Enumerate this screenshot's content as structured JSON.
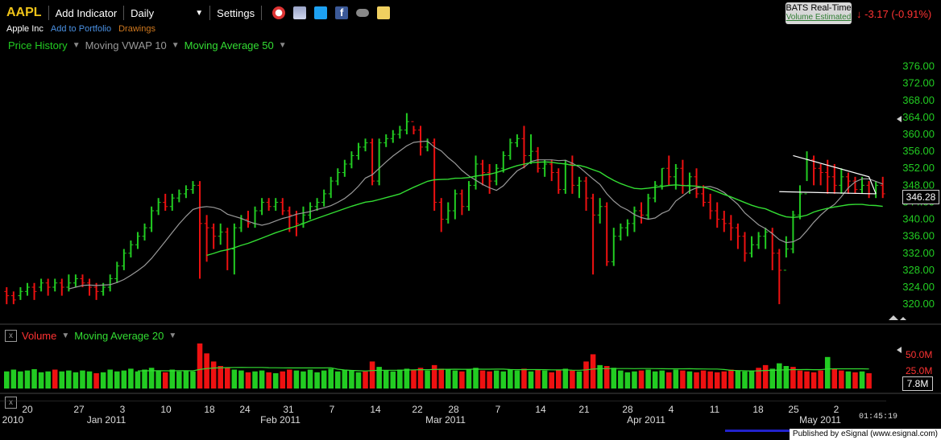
{
  "toolbar": {
    "symbol": "AAPL",
    "add_indicator": "Add Indicator",
    "interval": "Daily",
    "settings": "Settings",
    "icons": [
      "alarm-clock-icon",
      "cylinder-icon",
      "twitter-icon",
      "facebook-icon",
      "binoculars-icon",
      "note-icon"
    ],
    "realtime_title": "BATS Real-Time",
    "realtime_sub": "Volume Estimated",
    "change": "-3.17 (-0.91%)"
  },
  "subbar": {
    "company": "Apple Inc",
    "portfolio": "Add to Portfolio",
    "drawings": "Drawings"
  },
  "indicators": {
    "price_history": "Price History",
    "vwap": "Moving VWAP 10",
    "ma50": "Moving Average 50"
  },
  "volume_pane": {
    "label": "Volume",
    "ma": "Moving Average 20",
    "ticks": [
      "50.0M",
      "25.0M"
    ],
    "current": "7.8M"
  },
  "price_axis": [
    "376.00",
    "372.00",
    "368.00",
    "364.00",
    "360.00",
    "356.00",
    "352.00",
    "348.00",
    "344.00",
    "340.00",
    "336.00",
    "332.00",
    "328.00",
    "324.00",
    "320.00"
  ],
  "current_price": "346.28",
  "x_axis": {
    "days": [
      "2010",
      "20",
      "27",
      "3",
      "10",
      "18",
      "24",
      "31",
      "7",
      "14",
      "22",
      "28",
      "7",
      "14",
      "21",
      "28",
      "4",
      "11",
      "18",
      "25",
      "2"
    ],
    "months": [
      "Jan 2011",
      "Feb 2011",
      "Mar 2011",
      "Apr 2011",
      "May 2011"
    ]
  },
  "clock": "01:45:19",
  "footer": "Published by eSignal (www.esignal.com)",
  "colors": {
    "up": "#22cc22",
    "down": "#ee1111",
    "ma50": "#33dd33",
    "vwap": "#999999",
    "accent": "#f0c419"
  },
  "chart_data": {
    "type": "ohlc",
    "ylim": [
      317,
      378
    ],
    "bars": [
      [
        323,
        322,
        320,
        324
      ],
      [
        322,
        321,
        320,
        323
      ],
      [
        322,
        323,
        321,
        324
      ],
      [
        323,
        324,
        322,
        325
      ],
      [
        324,
        323,
        321,
        325
      ],
      [
        324,
        325,
        323,
        326
      ],
      [
        325,
        324,
        322,
        326
      ],
      [
        324,
        325,
        323,
        326
      ],
      [
        325,
        324,
        322,
        326
      ],
      [
        324,
        325,
        323,
        327
      ],
      [
        325,
        326,
        324,
        327
      ],
      [
        326,
        325,
        324,
        327
      ],
      [
        325,
        324,
        322,
        326
      ],
      [
        324,
        323,
        321,
        325
      ],
      [
        323,
        324,
        322,
        325
      ],
      [
        324,
        326,
        323,
        327
      ],
      [
        326,
        329,
        325,
        330
      ],
      [
        329,
        332,
        328,
        333
      ],
      [
        332,
        334,
        331,
        335
      ],
      [
        334,
        336,
        333,
        337
      ],
      [
        336,
        338,
        335,
        339
      ],
      [
        338,
        342,
        337,
        343
      ],
      [
        342,
        344,
        341,
        345
      ],
      [
        344,
        343,
        342,
        346
      ],
      [
        343,
        345,
        342,
        346
      ],
      [
        345,
        346,
        344,
        347
      ],
      [
        346,
        347,
        345,
        348
      ],
      [
        347,
        348,
        346,
        349
      ],
      [
        348,
        339,
        326,
        349
      ],
      [
        339,
        338,
        330,
        341
      ],
      [
        338,
        336,
        333,
        339
      ],
      [
        336,
        337,
        334,
        339
      ],
      [
        337,
        333,
        328,
        338
      ],
      [
        333,
        338,
        327,
        339
      ],
      [
        338,
        340,
        337,
        341
      ],
      [
        340,
        339,
        338,
        342
      ],
      [
        339,
        342,
        338,
        343
      ],
      [
        342,
        344,
        341,
        345
      ],
      [
        344,
        343,
        342,
        345
      ],
      [
        343,
        344,
        342,
        345
      ],
      [
        344,
        342,
        341,
        345
      ],
      [
        342,
        341,
        337,
        343
      ],
      [
        341,
        339,
        336,
        342
      ],
      [
        339,
        341,
        338,
        343
      ],
      [
        341,
        343,
        340,
        344
      ],
      [
        343,
        344,
        342,
        345
      ],
      [
        344,
        346,
        343,
        347
      ],
      [
        346,
        349,
        345,
        350
      ],
      [
        349,
        351,
        348,
        352
      ],
      [
        351,
        353,
        350,
        354
      ],
      [
        353,
        355,
        352,
        356
      ],
      [
        355,
        357,
        354,
        358
      ],
      [
        357,
        358,
        356,
        359
      ],
      [
        358,
        349,
        348,
        359
      ],
      [
        349,
        358,
        348,
        359
      ],
      [
        358,
        359,
        357,
        360
      ],
      [
        359,
        360,
        358,
        361
      ],
      [
        360,
        361,
        359,
        362
      ],
      [
        361,
        363,
        360,
        365
      ],
      [
        363,
        361,
        360,
        362
      ],
      [
        361,
        357,
        355,
        362
      ],
      [
        357,
        358,
        356,
        359
      ],
      [
        358,
        344,
        342,
        359
      ],
      [
        344,
        340,
        337,
        345
      ],
      [
        340,
        342,
        339,
        344
      ],
      [
        342,
        346,
        340,
        347
      ],
      [
        346,
        343,
        341,
        347
      ],
      [
        343,
        348,
        342,
        349
      ],
      [
        348,
        353,
        347,
        355
      ],
      [
        353,
        351,
        348,
        354
      ],
      [
        351,
        349,
        346,
        353
      ],
      [
        349,
        352,
        348,
        353
      ],
      [
        352,
        355,
        351,
        356
      ],
      [
        355,
        358,
        354,
        359
      ],
      [
        358,
        359,
        357,
        360
      ],
      [
        359,
        355,
        352,
        362
      ],
      [
        355,
        356,
        353,
        360
      ],
      [
        356,
        352,
        351,
        357
      ],
      [
        352,
        353,
        350,
        354
      ],
      [
        353,
        351,
        349,
        354
      ],
      [
        351,
        347,
        346,
        352
      ],
      [
        347,
        353,
        346,
        354
      ],
      [
        353,
        348,
        346,
        355
      ],
      [
        348,
        349,
        345,
        350
      ],
      [
        349,
        345,
        342,
        350
      ],
      [
        345,
        341,
        327,
        346
      ],
      [
        341,
        343,
        339,
        345
      ],
      [
        343,
        330,
        329,
        344
      ],
      [
        330,
        336,
        329,
        338
      ],
      [
        336,
        338,
        335,
        339
      ],
      [
        338,
        339,
        336,
        340
      ],
      [
        339,
        342,
        337,
        343
      ],
      [
        342,
        341,
        339,
        344
      ],
      [
        341,
        345,
        340,
        346
      ],
      [
        345,
        348,
        344,
        349
      ],
      [
        348,
        352,
        347,
        352
      ],
      [
        352,
        350,
        348,
        355
      ],
      [
        350,
        352,
        347,
        353
      ],
      [
        352,
        348,
        346,
        354
      ],
      [
        348,
        350,
        346,
        351
      ],
      [
        350,
        346,
        345,
        352
      ],
      [
        346,
        344,
        343,
        348
      ],
      [
        344,
        342,
        340,
        346
      ],
      [
        342,
        340,
        338,
        344
      ],
      [
        340,
        339,
        337,
        342
      ],
      [
        339,
        338,
        335,
        341
      ],
      [
        338,
        336,
        333,
        339
      ],
      [
        336,
        332,
        330,
        337
      ],
      [
        332,
        334,
        331,
        336
      ],
      [
        334,
        336,
        333,
        337
      ],
      [
        336,
        337,
        333,
        338
      ],
      [
        337,
        332,
        328,
        338
      ],
      [
        332,
        328,
        320,
        333
      ],
      [
        328,
        333,
        331,
        336
      ],
      [
        333,
        341,
        332,
        342
      ],
      [
        341,
        346,
        340,
        348
      ],
      [
        346,
        354,
        349,
        356
      ],
      [
        354,
        352,
        348,
        355
      ],
      [
        352,
        351,
        348,
        353
      ],
      [
        351,
        350,
        346,
        354
      ],
      [
        350,
        348,
        346,
        353
      ],
      [
        348,
        350,
        346,
        352
      ],
      [
        350,
        349,
        346,
        351
      ],
      [
        349,
        347,
        346,
        350
      ],
      [
        347,
        348,
        346,
        350
      ],
      [
        348,
        346,
        345,
        349
      ],
      [
        346,
        348,
        345,
        349
      ],
      [
        348,
        346,
        345,
        350
      ]
    ],
    "volume": [
      [
        0.38,
        "up"
      ],
      [
        0.42,
        "up"
      ],
      [
        0.38,
        "up"
      ],
      [
        0.4,
        "up"
      ],
      [
        0.43,
        "up"
      ],
      [
        0.36,
        "up"
      ],
      [
        0.38,
        "up"
      ],
      [
        0.42,
        "down"
      ],
      [
        0.38,
        "up"
      ],
      [
        0.4,
        "up"
      ],
      [
        0.36,
        "up"
      ],
      [
        0.4,
        "up"
      ],
      [
        0.38,
        "up"
      ],
      [
        0.34,
        "down"
      ],
      [
        0.36,
        "up"
      ],
      [
        0.42,
        "up"
      ],
      [
        0.38,
        "up"
      ],
      [
        0.4,
        "up"
      ],
      [
        0.44,
        "up"
      ],
      [
        0.38,
        "up"
      ],
      [
        0.42,
        "up"
      ],
      [
        0.46,
        "up"
      ],
      [
        0.4,
        "up"
      ],
      [
        0.36,
        "down"
      ],
      [
        0.42,
        "up"
      ],
      [
        0.38,
        "up"
      ],
      [
        0.4,
        "up"
      ],
      [
        0.38,
        "up"
      ],
      [
        1.0,
        "down"
      ],
      [
        0.78,
        "down"
      ],
      [
        0.6,
        "down"
      ],
      [
        0.5,
        "down"
      ],
      [
        0.46,
        "down"
      ],
      [
        0.42,
        "up"
      ],
      [
        0.4,
        "up"
      ],
      [
        0.36,
        "down"
      ],
      [
        0.38,
        "up"
      ],
      [
        0.4,
        "up"
      ],
      [
        0.36,
        "down"
      ],
      [
        0.34,
        "up"
      ],
      [
        0.38,
        "down"
      ],
      [
        0.42,
        "down"
      ],
      [
        0.4,
        "up"
      ],
      [
        0.38,
        "up"
      ],
      [
        0.42,
        "up"
      ],
      [
        0.36,
        "up"
      ],
      [
        0.4,
        "up"
      ],
      [
        0.44,
        "up"
      ],
      [
        0.38,
        "up"
      ],
      [
        0.42,
        "up"
      ],
      [
        0.4,
        "up"
      ],
      [
        0.36,
        "up"
      ],
      [
        0.38,
        "down"
      ],
      [
        0.6,
        "down"
      ],
      [
        0.48,
        "up"
      ],
      [
        0.4,
        "up"
      ],
      [
        0.38,
        "up"
      ],
      [
        0.42,
        "up"
      ],
      [
        0.44,
        "up"
      ],
      [
        0.42,
        "down"
      ],
      [
        0.46,
        "down"
      ],
      [
        0.4,
        "up"
      ],
      [
        0.52,
        "down"
      ],
      [
        0.44,
        "down"
      ],
      [
        0.42,
        "up"
      ],
      [
        0.4,
        "up"
      ],
      [
        0.38,
        "down"
      ],
      [
        0.42,
        "up"
      ],
      [
        0.46,
        "up"
      ],
      [
        0.4,
        "down"
      ],
      [
        0.38,
        "down"
      ],
      [
        0.4,
        "up"
      ],
      [
        0.38,
        "up"
      ],
      [
        0.42,
        "up"
      ],
      [
        0.4,
        "up"
      ],
      [
        0.44,
        "down"
      ],
      [
        0.38,
        "up"
      ],
      [
        0.42,
        "down"
      ],
      [
        0.4,
        "up"
      ],
      [
        0.36,
        "down"
      ],
      [
        0.42,
        "down"
      ],
      [
        0.44,
        "up"
      ],
      [
        0.4,
        "down"
      ],
      [
        0.38,
        "up"
      ],
      [
        0.6,
        "down"
      ],
      [
        0.76,
        "down"
      ],
      [
        0.52,
        "up"
      ],
      [
        0.5,
        "down"
      ],
      [
        0.46,
        "up"
      ],
      [
        0.4,
        "up"
      ],
      [
        0.36,
        "up"
      ],
      [
        0.38,
        "up"
      ],
      [
        0.4,
        "down"
      ],
      [
        0.42,
        "up"
      ],
      [
        0.38,
        "up"
      ],
      [
        0.4,
        "up"
      ],
      [
        0.36,
        "down"
      ],
      [
        0.42,
        "up"
      ],
      [
        0.4,
        "down"
      ],
      [
        0.38,
        "up"
      ],
      [
        0.36,
        "down"
      ],
      [
        0.4,
        "down"
      ],
      [
        0.38,
        "down"
      ],
      [
        0.36,
        "down"
      ],
      [
        0.38,
        "down"
      ],
      [
        0.42,
        "down"
      ],
      [
        0.4,
        "up"
      ],
      [
        0.38,
        "up"
      ],
      [
        0.4,
        "up"
      ],
      [
        0.46,
        "down"
      ],
      [
        0.52,
        "down"
      ],
      [
        0.44,
        "up"
      ],
      [
        0.56,
        "up"
      ],
      [
        0.5,
        "up"
      ],
      [
        0.48,
        "down"
      ],
      [
        0.4,
        "down"
      ],
      [
        0.38,
        "down"
      ],
      [
        0.36,
        "down"
      ],
      [
        0.4,
        "down"
      ],
      [
        0.7,
        "up"
      ],
      [
        0.44,
        "down"
      ],
      [
        0.4,
        "down"
      ],
      [
        0.38,
        "up"
      ],
      [
        0.36,
        "down"
      ],
      [
        0.38,
        "up"
      ],
      [
        0.34,
        "down"
      ]
    ]
  }
}
